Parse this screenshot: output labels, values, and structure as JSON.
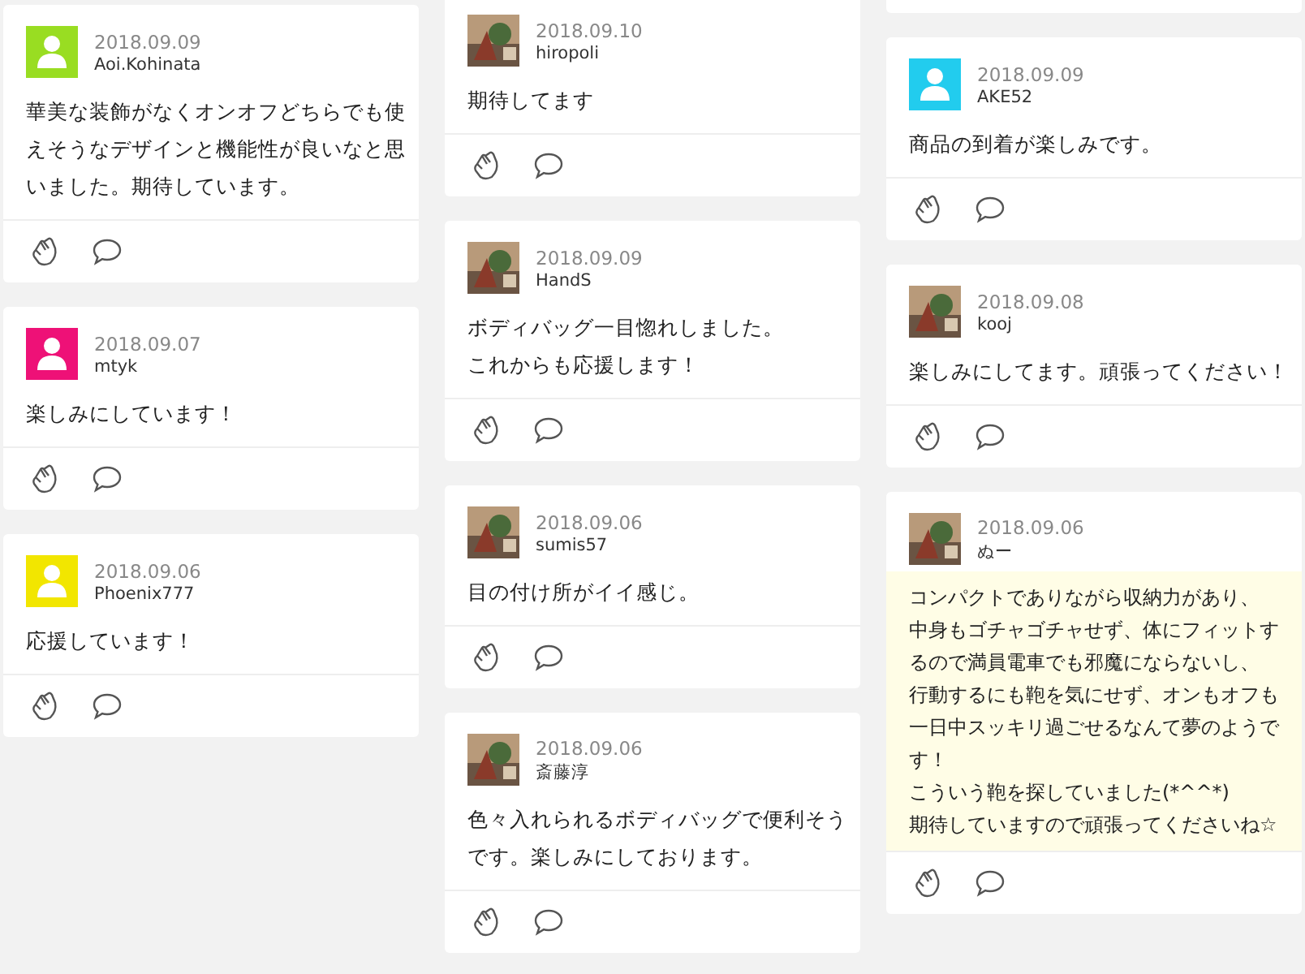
{
  "columns": [
    {
      "cards": [
        {
          "kind": "comment",
          "date": "2018.09.09",
          "user": "Aoi.Kohinata",
          "avatar": {
            "kind": "default",
            "color": "#99dd22"
          },
          "text": "華美な装飾がなくオンオフどちらでも使えそうなデザインと機能性が良いなと思いました。期待しています。",
          "highlighted": false
        },
        {
          "kind": "comment",
          "date": "2018.09.07",
          "user": "mtyk",
          "avatar": {
            "kind": "default",
            "color": "#ee1177"
          },
          "text": "楽しみにしています！",
          "highlighted": false
        },
        {
          "kind": "comment",
          "date": "2018.09.06",
          "user": "Phoenix777",
          "avatar": {
            "kind": "default",
            "color": "#f2e600"
          },
          "text": "応援しています！",
          "highlighted": false
        }
      ]
    },
    {
      "cards": [
        {
          "kind": "comment",
          "date": "2018.09.10",
          "user": "hiropoli",
          "avatar": {
            "kind": "picture"
          },
          "text": "期待してます",
          "highlighted": false
        },
        {
          "kind": "comment",
          "date": "2018.09.09",
          "user": "HandS",
          "avatar": {
            "kind": "picture"
          },
          "text": [
            "ボディバッグ一目惚れしました。",
            "これからも応援します！"
          ],
          "highlighted": false
        },
        {
          "kind": "comment",
          "date": "2018.09.06",
          "user": "sumis57",
          "avatar": {
            "kind": "picture"
          },
          "text": "目の付け所がイイ感じ。",
          "highlighted": false
        },
        {
          "kind": "comment",
          "date": "2018.09.06",
          "user": "斎藤淳",
          "avatar": {
            "kind": "picture"
          },
          "text": "色々入れられるボディバッグで便利そうです。楽しみにしております。",
          "highlighted": false
        }
      ]
    },
    {
      "cards": [
        {
          "kind": "stub"
        },
        {
          "kind": "comment",
          "date": "2018.09.09",
          "user": "AKE52",
          "avatar": {
            "kind": "default",
            "color": "#22ccee"
          },
          "text": "商品の到着が楽しみです。",
          "highlighted": false
        },
        {
          "kind": "comment",
          "date": "2018.09.08",
          "user": "kooj",
          "avatar": {
            "kind": "picture"
          },
          "text": "楽しみにしてます。頑張ってください！",
          "highlighted": false
        },
        {
          "kind": "comment",
          "date": "2018.09.06",
          "user": "ぬー",
          "avatar": {
            "kind": "picture"
          },
          "text": [
            "コンパクトでありながら収納力があり、",
            "中身もゴチャゴチャせず、体にフィットするので満員電車でも邪魔にならないし、",
            "行動するにも鞄を気にせず、オンもオフも一日中スッキリ過ごせるなんて夢のようです！",
            "こういう鞄を探していました(*^^*)",
            "期待していますので頑張ってくださいね☆"
          ],
          "highlighted": true
        }
      ]
    }
  ]
}
